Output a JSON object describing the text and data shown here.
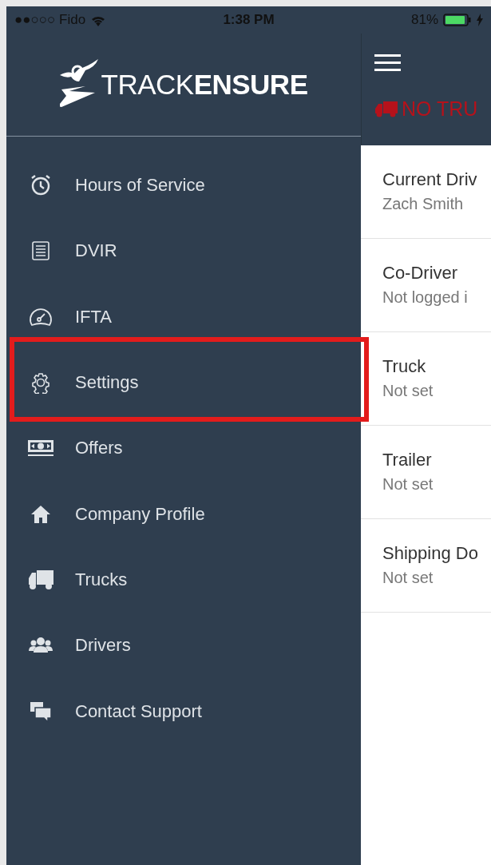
{
  "status_bar": {
    "carrier": "●●○○○ Fido",
    "time": "1:38 PM",
    "battery": "81%"
  },
  "sidebar": {
    "logo": "TRACK**ENSURE**",
    "items": [
      {
        "label": "Hours of Service",
        "highlighted": false
      },
      {
        "label": "DVIR",
        "highlighted": false
      },
      {
        "label": "IFTA",
        "highlighted": false
      },
      {
        "label": "Settings",
        "highlighted": true
      },
      {
        "label": "Offers",
        "highlighted": false
      },
      {
        "label": "Company Profile",
        "highlighted": false
      },
      {
        "label": "Trucks",
        "highlighted": false
      },
      {
        "label": "Drivers",
        "highlighted": false
      },
      {
        "label": "Contact Support",
        "highlighted": false
      }
    ]
  },
  "main": {
    "alert": "NO TRU",
    "rows": [
      {
        "title": "Current Driv",
        "value": "Zach Smith"
      },
      {
        "title": "Co-Driver",
        "value": "Not logged i"
      },
      {
        "title": "Truck",
        "value": "Not set"
      },
      {
        "title": "Trailer",
        "value": "Not set"
      },
      {
        "title": "Shipping Do",
        "value": "Not set"
      }
    ]
  }
}
